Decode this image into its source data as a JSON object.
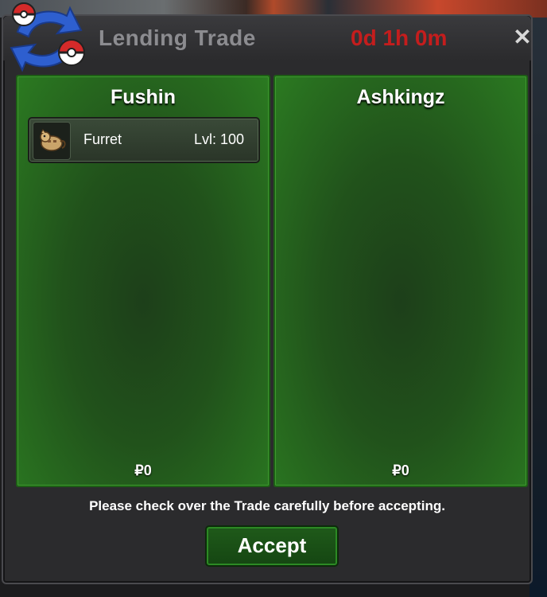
{
  "window": {
    "title": "Lending Trade",
    "timer": "0d 1h 0m"
  },
  "panels": [
    {
      "name": "Fushin",
      "money": "₽0",
      "items": [
        {
          "name": "Furret",
          "level": "Lvl: 100",
          "icon": "furret-sprite-icon"
        }
      ]
    },
    {
      "name": "Ashkingz",
      "money": "₽0",
      "items": []
    }
  ],
  "hint": "Please check over the Trade carefully before accepting.",
  "accept_label": "Accept",
  "colors": {
    "panel_green": "#21521b",
    "timer_red": "#c41d1d",
    "window_bg": "#2b2b2d"
  }
}
